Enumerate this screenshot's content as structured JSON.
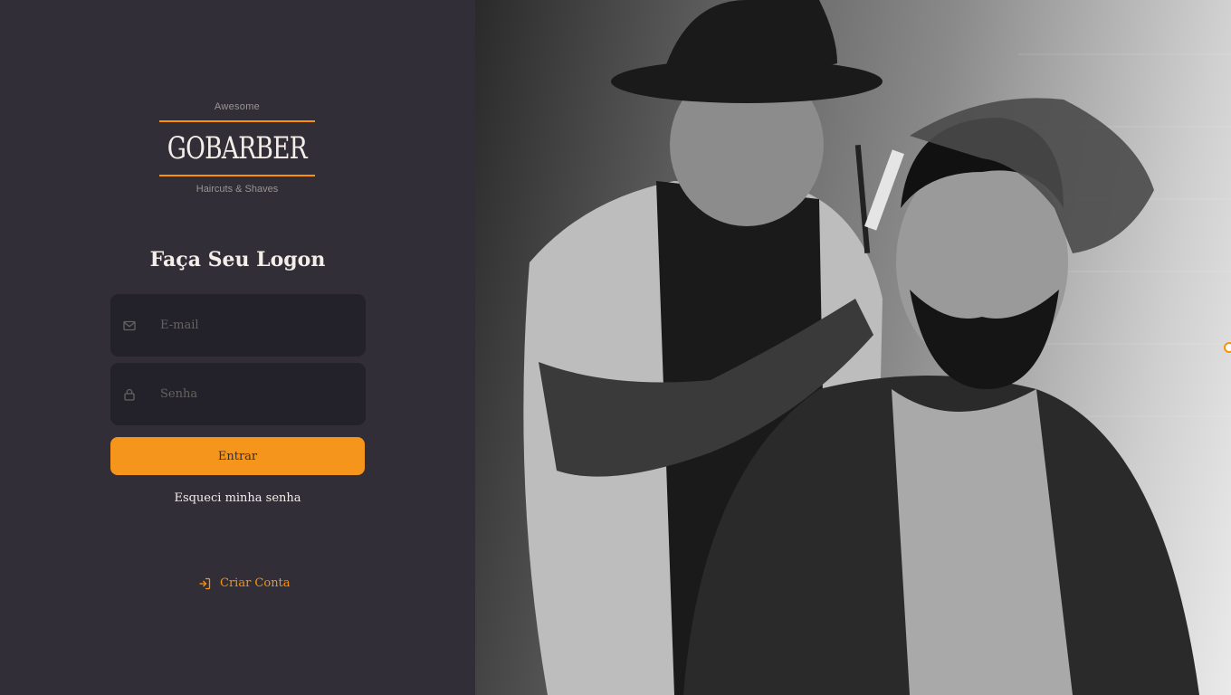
{
  "logo": {
    "tagline_top": "Awesome",
    "brand": "GOBARBER",
    "tagline_bottom": "Haircuts & Shaves"
  },
  "form": {
    "title": "Faça Seu Logon",
    "email": {
      "placeholder": "E-mail",
      "value": "",
      "icon": "mail-icon"
    },
    "password": {
      "placeholder": "Senha",
      "value": "",
      "icon": "lock-icon"
    },
    "submit_label": "Entrar",
    "forgot_label": "Esqueci minha senha"
  },
  "signup": {
    "label": "Criar Conta",
    "icon": "log-in-icon"
  },
  "colors": {
    "background": "#312e38",
    "input_background": "#232129",
    "accent": "#ff9000",
    "button": "#f6951b",
    "text": "#f4ede8",
    "placeholder": "#666360"
  }
}
